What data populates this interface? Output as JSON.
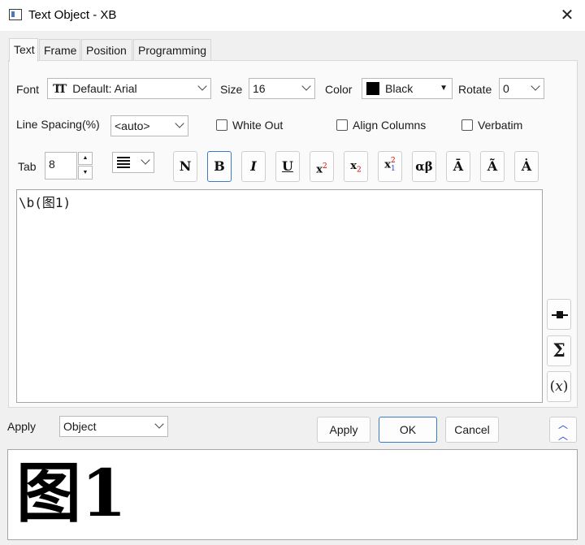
{
  "window": {
    "title": "Text Object - XB",
    "close_glyph": "✕"
  },
  "tabs": [
    {
      "label": "Text",
      "active": true
    },
    {
      "label": "Frame",
      "active": false
    },
    {
      "label": "Position",
      "active": false
    },
    {
      "label": "Programming",
      "active": false
    }
  ],
  "font": {
    "label": "Font",
    "value": "Default: Arial",
    "icon": "truetype-font-icon"
  },
  "size": {
    "label": "Size",
    "value": "16"
  },
  "color": {
    "label": "Color",
    "value": "Black",
    "swatch": "#000000"
  },
  "rotate": {
    "label": "Rotate",
    "value": "0"
  },
  "line_spacing": {
    "label": "Line Spacing(%)",
    "value": "<auto>"
  },
  "checkboxes": {
    "white_out": {
      "label": "White Out",
      "checked": false
    },
    "align_columns": {
      "label": "Align Columns",
      "checked": false
    },
    "verbatim": {
      "label": "Verbatim",
      "checked": false
    }
  },
  "tab_setting": {
    "label": "Tab",
    "value": "8"
  },
  "format_buttons": [
    "N",
    "B",
    "I",
    "U",
    "x²",
    "x₂",
    "x²₁",
    "αβ",
    "Ā",
    "Ã",
    "Ȧ"
  ],
  "selected_format": "B",
  "editor": {
    "content": "\\b(图1)"
  },
  "side_buttons": [
    "insert-object-icon",
    "sigma-icon",
    "function-x-icon"
  ],
  "apply_scope": {
    "label": "Apply",
    "value": "Object"
  },
  "buttons": {
    "apply": "Apply",
    "ok": "OK",
    "cancel": "Cancel"
  },
  "preview": {
    "text": "图1"
  },
  "accent": "#3a7cc7"
}
